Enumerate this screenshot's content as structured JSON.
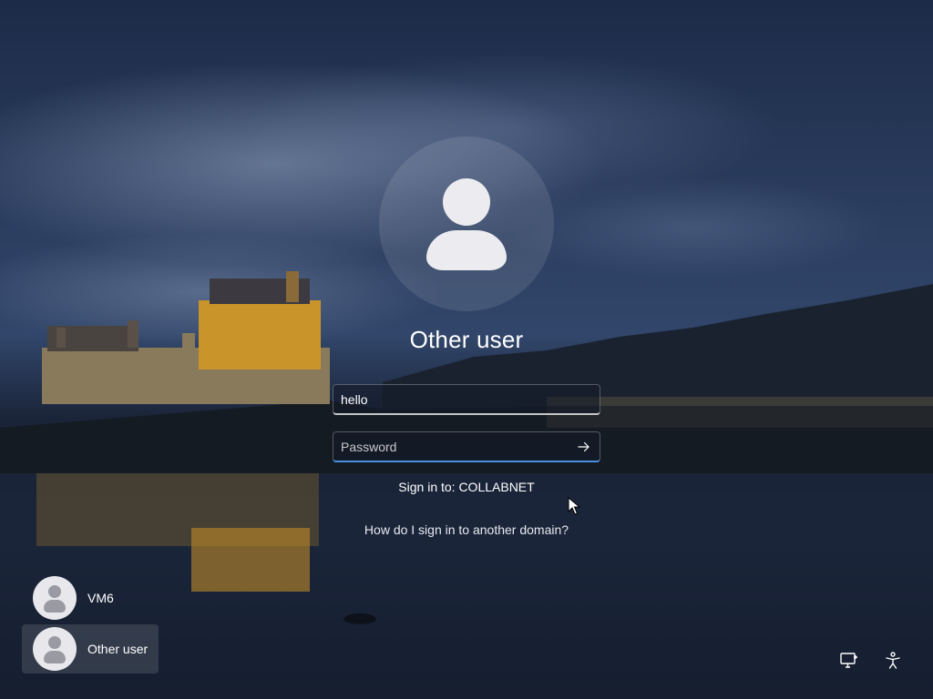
{
  "login": {
    "user_name": "Other user",
    "username_value": "hello",
    "password_placeholder": "Password",
    "sign_in_domain": "Sign in to: COLLABNET",
    "domain_help_link": "How do I sign in to another domain?"
  },
  "user_list": [
    {
      "label": "VM6",
      "selected": false
    },
    {
      "label": "Other user",
      "selected": true
    }
  ],
  "system_icons": [
    "network-icon",
    "accessibility-icon"
  ]
}
